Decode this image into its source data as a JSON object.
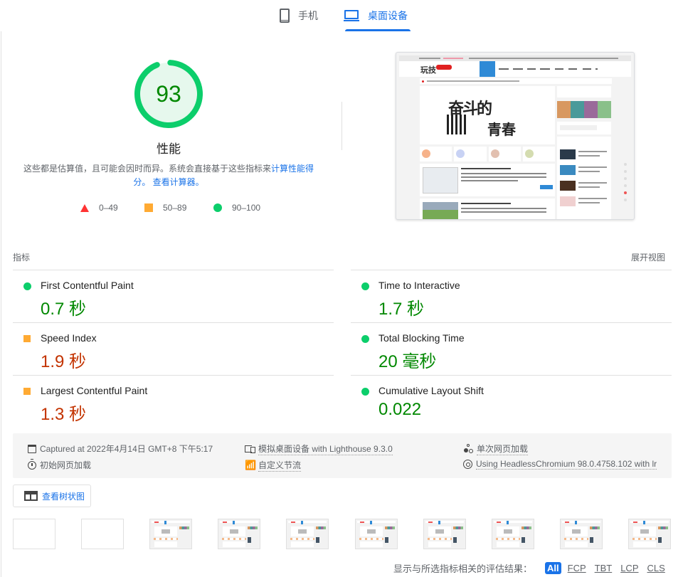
{
  "tabs": [
    {
      "label": "手机",
      "icon": "phone-icon",
      "active": false
    },
    {
      "label": "桌面设备",
      "icon": "laptop-icon",
      "active": true
    }
  ],
  "gauge": {
    "score": "93",
    "score_fraction": 0.93,
    "title": "性能",
    "description": "这些都是估算值，且可能会因时而异。系统会直接基于这些指标来",
    "link_calc_score": "计算性能得分。",
    "link_view_calculator": "查看计算器。",
    "color": "#0cce6b"
  },
  "legend": [
    {
      "shape": "triangle",
      "range": "0–49",
      "color": "#ff3333"
    },
    {
      "shape": "square",
      "range": "50–89",
      "color": "#ffaa33"
    },
    {
      "shape": "circle",
      "range": "90–100",
      "color": "#0cce6b"
    }
  ],
  "metrics": {
    "header": "指标",
    "expand_link": "展开视图",
    "items": [
      {
        "name": "First Contentful Paint",
        "value": "0.7 秒",
        "rating": "pass"
      },
      {
        "name": "Time to Interactive",
        "value": "1.7 秒",
        "rating": "pass"
      },
      {
        "name": "Speed Index",
        "value": "1.9 秒",
        "rating": "average"
      },
      {
        "name": "Total Blocking Time",
        "value": "20 毫秒",
        "rating": "pass"
      },
      {
        "name": "Largest Contentful Paint",
        "value": "1.3 秒",
        "rating": "average"
      },
      {
        "name": "Cumulative Layout Shift",
        "value": "0.022",
        "rating": "pass"
      }
    ]
  },
  "screenshot": {
    "site_logo": "玩技",
    "hero_text": "奋斗的",
    "hero_sub": "青春"
  },
  "meta": {
    "captured": "Captured at 2022年4月14日 GMT+8 下午5:17",
    "device": "模拟桌面设备 with Lighthouse 9.3.0",
    "load_type": "单次网页加载",
    "initial_load": "初始网页加载",
    "throttling": "自定义节流",
    "browser": "Using HeadlessChromium 98.0.4758.102 with lr"
  },
  "treemap_button": "查看树状图",
  "filmstrip": {
    "frames": [
      false,
      false,
      true,
      true,
      true,
      true,
      true,
      true,
      true,
      true
    ]
  },
  "filter": {
    "label": "显示与所选指标相关的评估结果：",
    "chips": [
      {
        "label": "All",
        "active": true
      },
      {
        "label": "FCP",
        "active": false
      },
      {
        "label": "TBT",
        "active": false
      },
      {
        "label": "LCP",
        "active": false
      },
      {
        "label": "CLS",
        "active": false
      }
    ]
  }
}
